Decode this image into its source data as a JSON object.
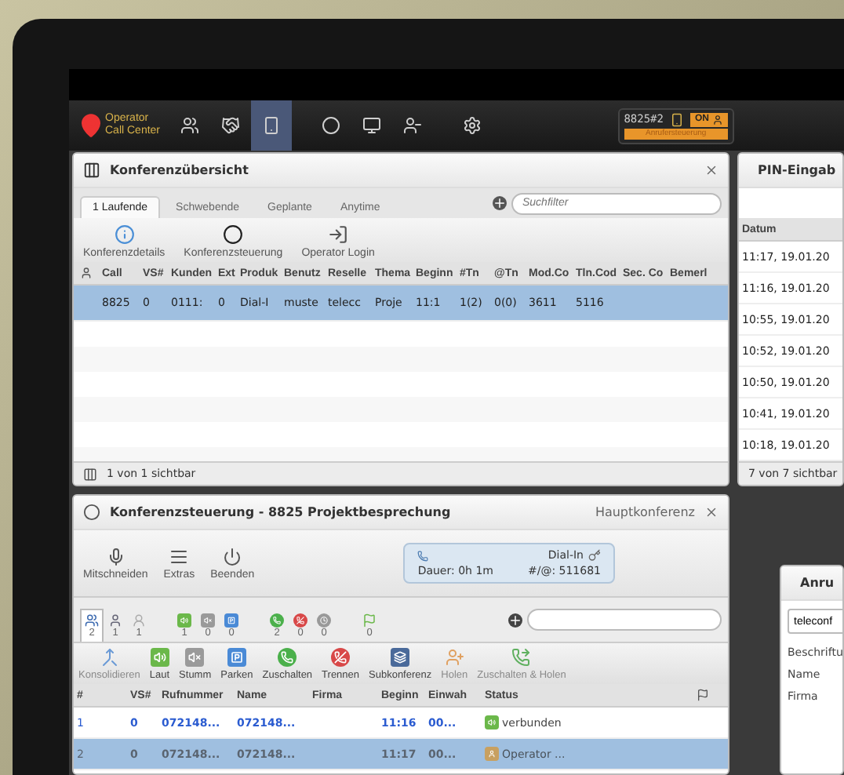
{
  "toolbar": {
    "logo": [
      "Operator",
      "Call Center"
    ],
    "buttons": [
      {
        "kind": "users",
        "selected": false
      },
      {
        "kind": "handshake",
        "selected": false
      },
      {
        "kind": "phone",
        "selected": true
      },
      {
        "kind": "circle",
        "selected": false
      },
      {
        "kind": "monitor",
        "selected": false
      },
      {
        "kind": "people",
        "selected": false
      },
      {
        "kind": "settings",
        "selected": false
      }
    ],
    "extension": "8825#2",
    "toggle": {
      "label": "ON",
      "on": true
    },
    "status_button": "Anrufersteuerung"
  },
  "overview": {
    "title": "Konferenzübersicht",
    "tabs": [
      {
        "label": "1 Laufende",
        "selected": true
      },
      {
        "label": "Schwebende",
        "selected": false
      },
      {
        "label": "Geplante",
        "selected": false
      },
      {
        "label": "Anytime",
        "selected": false
      }
    ],
    "search": {
      "placeholder": "Suchfilter"
    },
    "actions": [
      {
        "kind": "info",
        "label": "Konferenzdetails"
      },
      {
        "kind": "ring",
        "label": "Konferenzsteuerung"
      },
      {
        "kind": "login",
        "label": "Operator Login"
      }
    ],
    "columns": [
      "Call",
      "VS#",
      "Kunden",
      "Ext",
      "Produk",
      "Benutz",
      "Reselle",
      "Thema",
      "Beginn",
      "#Tn",
      "@Tn",
      "Mod.Co",
      "Tln.Cod",
      "Sec. Co",
      "Bemerl"
    ],
    "rows": [
      {
        "selected": true,
        "cells": [
          "8825",
          "0",
          "0111:",
          "0",
          "Dial-I",
          "muste",
          "telecc",
          "Proje",
          "11:1",
          "1(2)",
          "0(0)",
          "3611",
          "5116",
          "",
          ""
        ]
      }
    ],
    "footer": "1 von 1 sichtbar"
  },
  "pin": {
    "title": "PIN-Eingab",
    "column": "Datum",
    "rows": [
      "11:17, 19.01.20",
      "11:16, 19.01.20",
      "10:55, 19.01.20",
      "10:52, 19.01.20",
      "10:50, 19.01.20",
      "10:41, 19.01.20",
      "10:18, 19.01.20"
    ],
    "footer": "7 von 7 sichtbar"
  },
  "control": {
    "title": "Konferenzsteuerung - 8825 Projektbesprechung",
    "context": "Hauptkonferenz",
    "actions": [
      {
        "kind": "mic",
        "label": "Mitschneiden"
      },
      {
        "kind": "list",
        "label": "Extras"
      },
      {
        "kind": "power",
        "label": "Beenden"
      }
    ],
    "info": {
      "mode": "Dial-In",
      "duration": "Dauer: 0h 1m",
      "pin": "#/@: 511681"
    },
    "counters": [
      {
        "kind": "all",
        "count": "2",
        "selected": true
      },
      {
        "kind": "person",
        "count": "1",
        "selected": false
      },
      {
        "kind": "guest",
        "count": "1",
        "selected": false
      },
      {
        "kind": "loud",
        "count": "1",
        "selected": false
      },
      {
        "kind": "mute",
        "count": "0",
        "selected": false
      },
      {
        "kind": "park",
        "count": "0",
        "selected": false
      },
      {
        "kind": "connected",
        "count": "2",
        "selected": false
      },
      {
        "kind": "hangup",
        "count": "0",
        "selected": false
      },
      {
        "kind": "waiting",
        "count": "0",
        "selected": false
      },
      {
        "kind": "flag",
        "count": "0",
        "selected": false
      }
    ],
    "tools": [
      {
        "kind": "merge",
        "label": "Konsolidieren",
        "disabled": true
      },
      {
        "kind": "loud",
        "label": "Laut",
        "disabled": false
      },
      {
        "kind": "mute",
        "label": "Stumm",
        "disabled": false
      },
      {
        "kind": "park",
        "label": "Parken",
        "disabled": false
      },
      {
        "kind": "connected",
        "label": "Zuschalten",
        "disabled": false
      },
      {
        "kind": "hangup",
        "label": "Trennen",
        "disabled": false
      },
      {
        "kind": "sub",
        "label": "Subkonferenz",
        "disabled": false
      },
      {
        "kind": "fetch",
        "label": "Holen",
        "disabled": true
      },
      {
        "kind": "fetchjoin",
        "label": "Zuschalten & Holen",
        "disabled": true
      }
    ],
    "columns": [
      "#",
      "VS#",
      "Rufnummer",
      "Name",
      "Firma",
      "Beginn",
      "Einwah",
      "Status"
    ],
    "rows": [
      {
        "no": "1",
        "vs": "0",
        "number": "072148...",
        "name": "072148...",
        "begin": "11:16",
        "dial": "00...",
        "status": "verbunden",
        "kind": "loud",
        "selected": false
      },
      {
        "no": "2",
        "vs": "0",
        "number": "072148...",
        "name": "072148...",
        "begin": "11:17",
        "dial": "00...",
        "status": "Operator ...",
        "kind": "operator",
        "selected": true
      }
    ]
  },
  "call": {
    "title": "Anru",
    "value": "teleconf",
    "labels": [
      "Beschriftu",
      "Name",
      "Firma"
    ]
  }
}
